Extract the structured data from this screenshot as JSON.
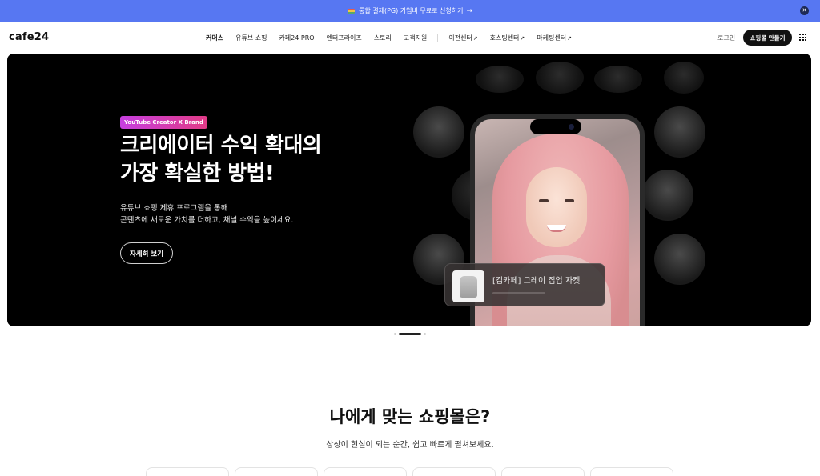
{
  "announcement": {
    "text": "통합 결제(PG) 가입비 무료로 신청하기",
    "arrow": "→",
    "close_glyph": "✕",
    "background": "#5777f2"
  },
  "header": {
    "logo": "cafe24",
    "nav": [
      {
        "label": "커머스",
        "external": false,
        "active": true
      },
      {
        "label": "유튜브 쇼핑",
        "external": false,
        "active": false
      },
      {
        "label": "카페24 PRO",
        "external": false,
        "active": false
      },
      {
        "label": "엔터프라이즈",
        "external": false,
        "active": false
      },
      {
        "label": "스토리",
        "external": false,
        "active": false
      },
      {
        "label": "고객지원",
        "external": false,
        "active": false
      },
      {
        "label": "이전센터",
        "external": true,
        "active": false
      },
      {
        "label": "호스팅센터",
        "external": true,
        "active": false
      },
      {
        "label": "마케팅센터",
        "external": true,
        "active": false
      }
    ],
    "external_glyph": "↗",
    "login": "로그인",
    "create_button": "쇼핑몰 만들기"
  },
  "hero": {
    "badge": "YouTube Creator X Brand",
    "title_line1": "크리에이터 수익 확대의",
    "title_line2": "가장 확실한 방법!",
    "desc_line1": "유튜브 쇼핑 제휴 프로그램을 통해",
    "desc_line2": "콘텐츠에 새로운 가치를 더하고, 채널 수익을 높이세요.",
    "cta": "자세히 보기",
    "product_name": "[김카페] 그레이 집업 자켓"
  },
  "carousel": {
    "slides": 3,
    "active_index": 1
  },
  "section": {
    "title": "나에게 맞는 쇼핑몰은?",
    "subtitle": "상상이 현실이 되는 순간, 쉽고 빠르게 펼쳐보세요."
  },
  "colors": {
    "accent": "#5777f2",
    "dark": "#111111",
    "badge_gradient": [
      "#c63fe0",
      "#e23b86"
    ]
  }
}
